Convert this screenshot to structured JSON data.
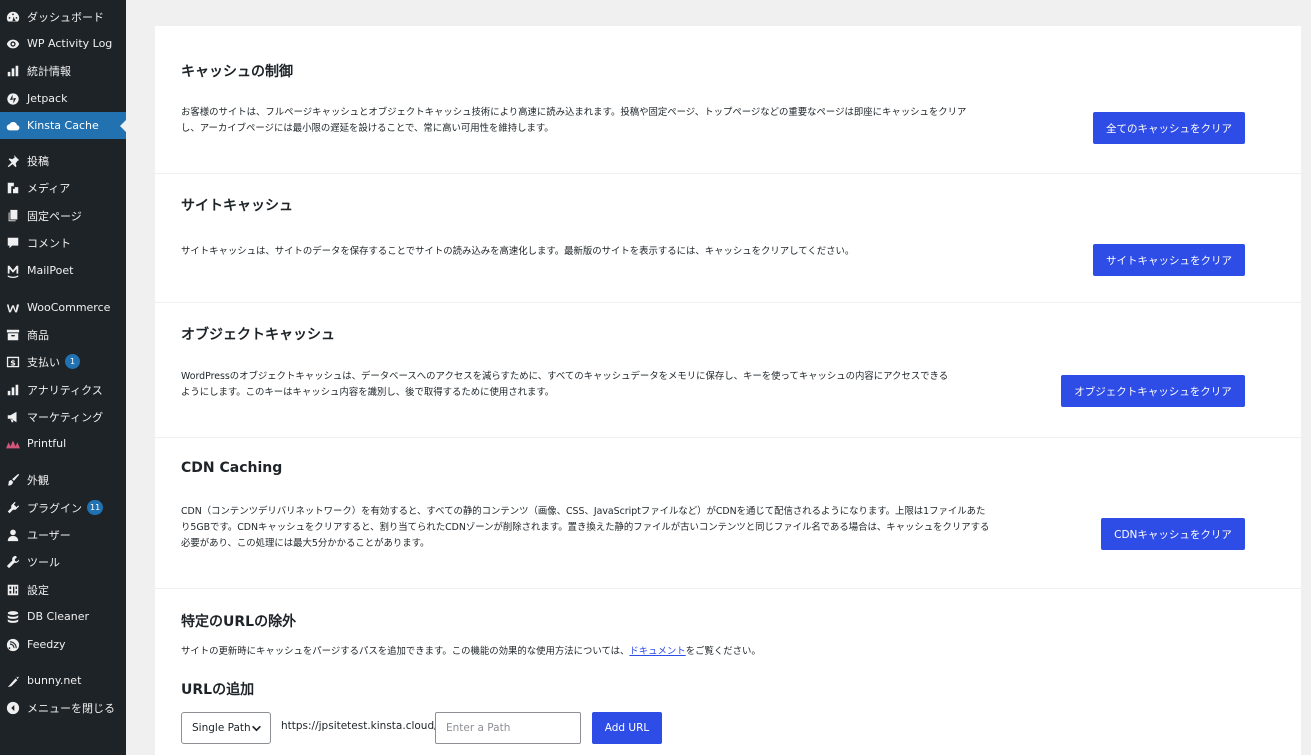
{
  "sidebar": {
    "items": [
      {
        "label": "ダッシュボード",
        "icon": "dashboard-icon"
      },
      {
        "label": "WP Activity Log",
        "icon": "eye-icon"
      },
      {
        "label": "統計情報",
        "icon": "bar-chart-icon"
      },
      {
        "label": "Jetpack",
        "icon": "jetpack-icon"
      },
      {
        "label": "Kinsta Cache",
        "icon": "cloud-icon"
      },
      {
        "label": "投稿",
        "icon": "pin-icon"
      },
      {
        "label": "メディア",
        "icon": "media-icon"
      },
      {
        "label": "固定ページ",
        "icon": "pages-icon"
      },
      {
        "label": "コメント",
        "icon": "comment-icon"
      },
      {
        "label": "MailPoet",
        "icon": "mailpoet-icon"
      },
      {
        "label": "WooCommerce",
        "icon": "woocommerce-icon"
      },
      {
        "label": "商品",
        "icon": "archive-icon"
      },
      {
        "label": "支払い",
        "icon": "dollar-icon",
        "badge": "1"
      },
      {
        "label": "アナリティクス",
        "icon": "analytics-icon"
      },
      {
        "label": "マーケティング",
        "icon": "megaphone-icon"
      },
      {
        "label": "Printful",
        "icon": "printful-icon"
      },
      {
        "label": "外観",
        "icon": "brush-icon"
      },
      {
        "label": "プラグイン",
        "icon": "plugin-icon",
        "badge": "11"
      },
      {
        "label": "ユーザー",
        "icon": "user-icon"
      },
      {
        "label": "ツール",
        "icon": "wrench-icon"
      },
      {
        "label": "設定",
        "icon": "settings-icon"
      },
      {
        "label": "DB Cleaner",
        "icon": "database-icon"
      },
      {
        "label": "Feedzy",
        "icon": "rss-icon"
      },
      {
        "label": "bunny.net",
        "icon": "carrot-icon"
      },
      {
        "label": "メニューを閉じる",
        "icon": "collapse-icon"
      }
    ]
  },
  "sections": {
    "cache_control": {
      "title": "キャッシュの制御",
      "desc1": "お客様のサイトは、フルページキャッシュとオブジェクトキャッシュ技術により高速に読み込まれます。投稿や固定ページ、トップページなどの重要なページは即座にキャッシュをクリア",
      "desc2": "し、アーカイブページには最小限の遅延を設けることで、常に高い可用性を維持します。",
      "button": "全てのキャッシュをクリア"
    },
    "site_cache": {
      "title": "サイトキャッシュ",
      "desc1": "サイトキャッシュは、サイトのデータを保存することでサイトの読み込みを高速化します。最新版のサイトを表示するには、キャッシュをクリアしてください。",
      "button": "サイトキャッシュをクリア"
    },
    "object_cache": {
      "title": "オブジェクトキャッシュ",
      "desc1": "WordPressのオブジェクトキャッシュは、データベースへのアクセスを減らすために、すべてのキャッシュデータをメモリに保存し、キーを使ってキャッシュの内容にアクセスできる",
      "desc2": "ようにします。このキーはキャッシュ内容を識別し、後で取得するために使用されます。",
      "button": "オブジェクトキャッシュをクリア"
    },
    "cdn_cache": {
      "title": "CDN Caching",
      "desc1": "CDN（コンテンツデリバリネットワーク）を有効すると、すべての静的コンテンツ（画像、CSS、JavaScriptファイルなど）がCDNを通じて配信されるようになります。上限は1ファイルあた",
      "desc2": "り5GBです。CDNキャッシュをクリアすると、割り当てられたCDNゾーンが削除されます。置き換えた静的ファイルが古いコンテンツと同じファイル名である場合は、キャッシュをクリアする",
      "desc3": "必要があり、この処理には最大5分かかることがあります。",
      "button": "CDNキャッシュをクリア"
    },
    "url_exclude": {
      "title": "特定のURLの除外",
      "desc_before": "サイトの更新時にキャッシュをパージするパスを追加できます。この機能の効果的な使用方法については、",
      "desc_link": "ドキュメント",
      "desc_after": "をご覧ください。",
      "add_title": "URLの追加",
      "select_value": "Single Path",
      "url_prefix": "https://jpsitetest.kinsta.cloud/",
      "path_placeholder": "Enter a Path",
      "add_button": "Add URL"
    }
  }
}
